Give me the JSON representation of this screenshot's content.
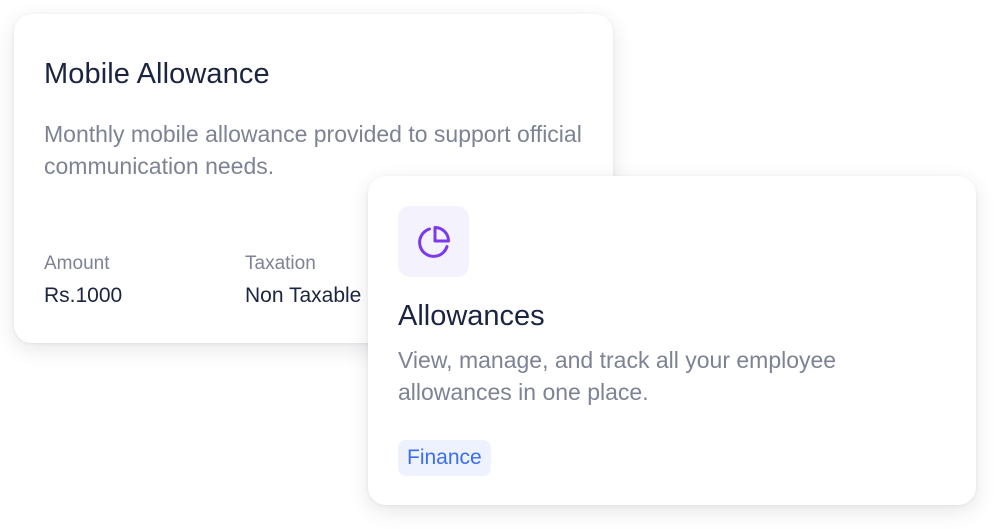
{
  "detail_card": {
    "title": "Mobile Allowance",
    "description": "Monthly mobile allowance provided to support official communication needs.",
    "amount_label": "Amount",
    "amount_value": "Rs.1000",
    "taxation_label": "Taxation",
    "taxation_value": "Non Taxable"
  },
  "feature_card": {
    "icon": "pie-chart-icon",
    "title": "Allowances",
    "description": "View, manage, and track all your employee allowances in one place.",
    "tag": "Finance"
  },
  "colors": {
    "heading": "#1b2440",
    "muted_text": "#7d8394",
    "icon_accent": "#7c3aed",
    "icon_tile_bg": "#f3f2fd",
    "tag_text": "#3b6ef0",
    "tag_bg": "#eef2fe"
  }
}
